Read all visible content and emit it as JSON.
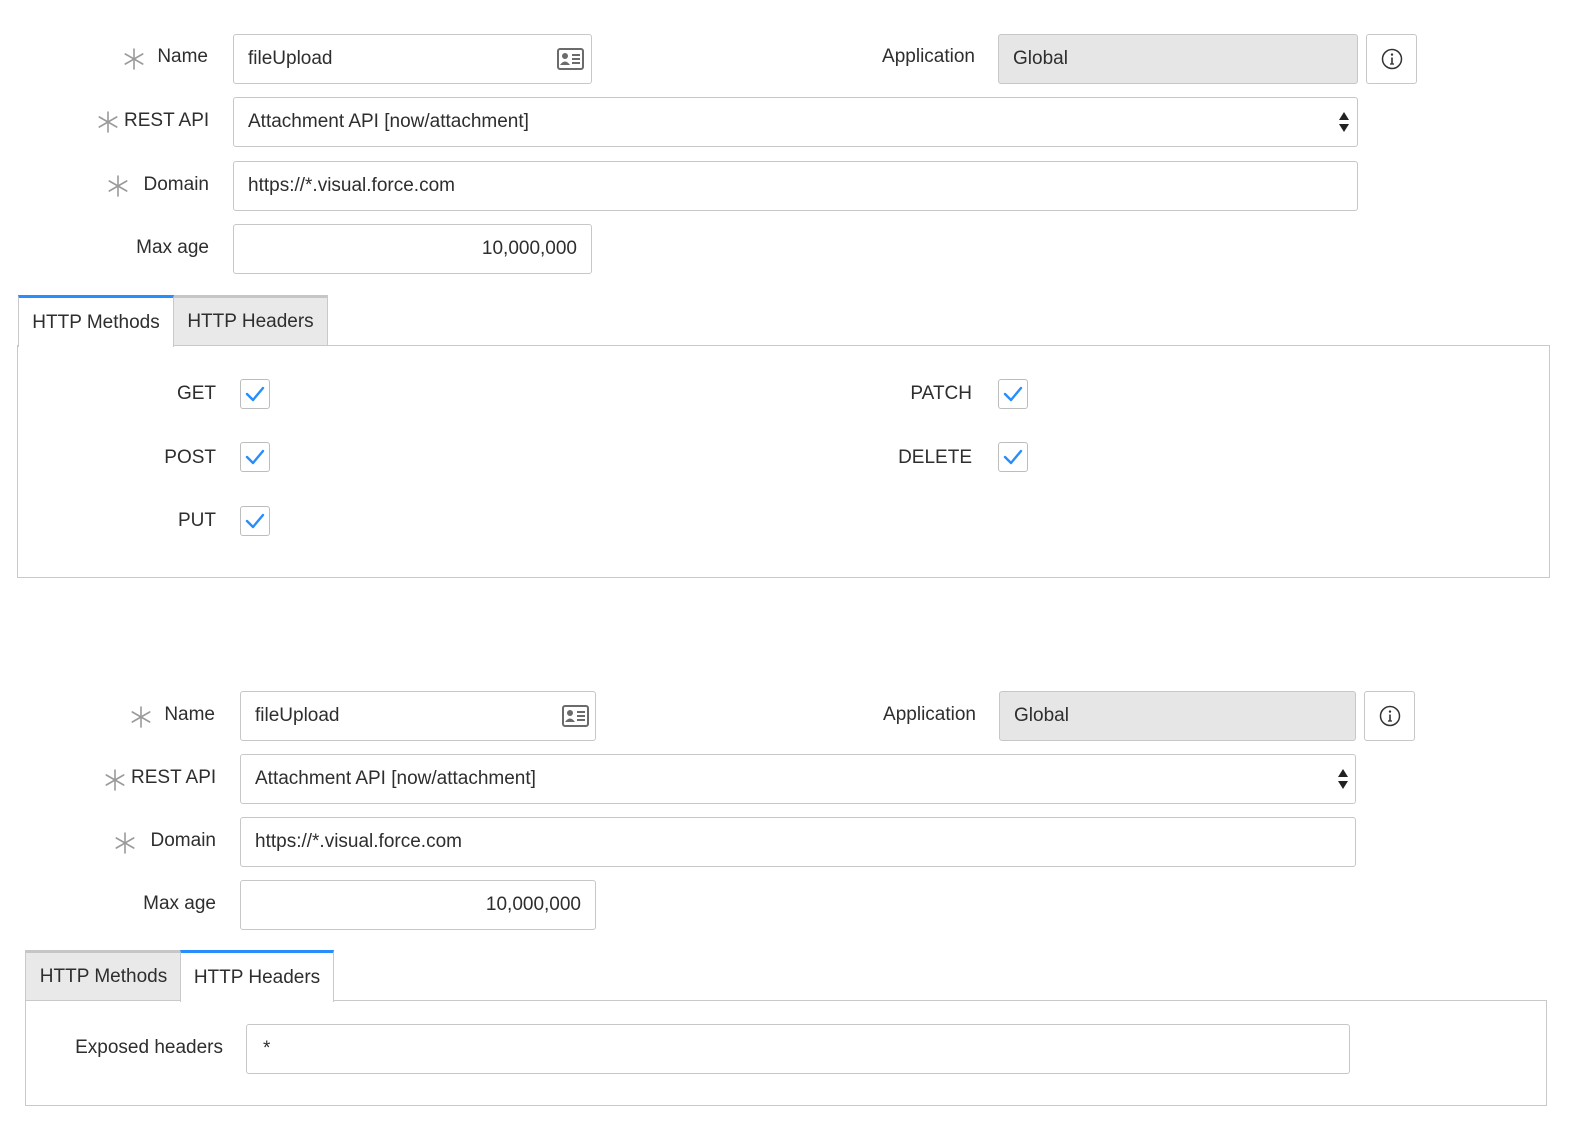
{
  "forms": [
    {
      "name_label": "Name",
      "name_value": "fileUpload",
      "application_label": "Application",
      "application_value": "Global",
      "rest_api_label": "REST API",
      "rest_api_value": "Attachment API [now/attachment]",
      "domain_label": "Domain",
      "domain_value": "https://*.visual.force.com",
      "max_age_label": "Max age",
      "max_age_value": "10,000,000",
      "tabs": [
        "HTTP Methods",
        "HTTP Headers"
      ],
      "active_tab": "HTTP Methods",
      "methods": [
        {
          "label": "GET",
          "checked": true
        },
        {
          "label": "POST",
          "checked": true
        },
        {
          "label": "PUT",
          "checked": true
        },
        {
          "label": "PATCH",
          "checked": true
        },
        {
          "label": "DELETE",
          "checked": true
        }
      ]
    },
    {
      "name_label": "Name",
      "name_value": "fileUpload",
      "application_label": "Application",
      "application_value": "Global",
      "rest_api_label": "REST API",
      "rest_api_value": "Attachment API [now/attachment]",
      "domain_label": "Domain",
      "domain_value": "https://*.visual.force.com",
      "max_age_label": "Max age",
      "max_age_value": "10,000,000",
      "tabs": [
        "HTTP Methods",
        "HTTP Headers"
      ],
      "active_tab": "HTTP Headers",
      "exposed_headers_label": "Exposed headers",
      "exposed_headers_value": "*"
    }
  ],
  "colors": {
    "accent": "#278efc",
    "readonly_bg": "#e6e6e6",
    "border": "#c7c7c7"
  },
  "icons": {
    "required": "asterisk-icon",
    "name_field": "contact-card-icon",
    "info": "info-icon",
    "select": "sort-arrows-icon",
    "checkbox": "check-icon"
  }
}
